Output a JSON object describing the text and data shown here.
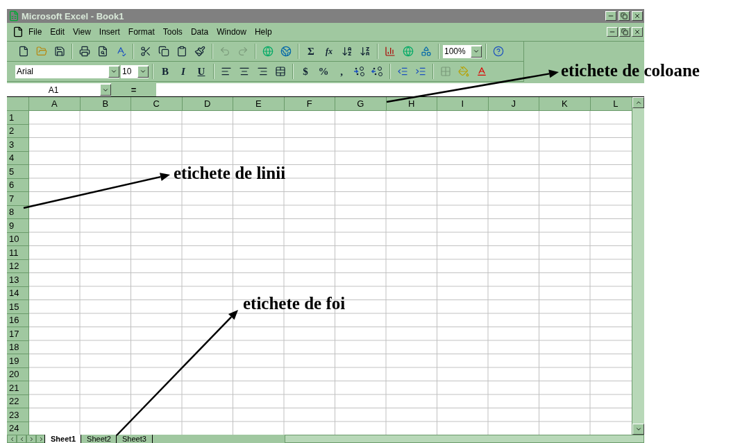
{
  "window": {
    "title": "Microsoft Excel - Book1"
  },
  "menu": [
    "File",
    "Edit",
    "View",
    "Insert",
    "Format",
    "Tools",
    "Data",
    "Window",
    "Help"
  ],
  "standard_toolbar": {
    "sum_label": "Σ",
    "function_label": "fx",
    "zoom": "100%"
  },
  "formatting_toolbar": {
    "font": "Arial",
    "size": "10",
    "bold": "B",
    "italic": "I",
    "underline": "U",
    "currency": "$",
    "percent": "%",
    "comma": ","
  },
  "formula_bar": {
    "name_box": "A1",
    "equals": "="
  },
  "columns": [
    "A",
    "B",
    "C",
    "D",
    "E",
    "F",
    "G",
    "H",
    "I",
    "J",
    "K",
    "L"
  ],
  "rows": [
    "1",
    "2",
    "3",
    "4",
    "5",
    "6",
    "7",
    "8",
    "9",
    "10",
    "11",
    "12",
    "13",
    "14",
    "15",
    "16",
    "17",
    "18",
    "19",
    "20",
    "21",
    "22",
    "23",
    "24"
  ],
  "sheet_tabs": [
    {
      "label": "Sheet1",
      "selected": true
    },
    {
      "label": "Sheet2",
      "selected": false
    },
    {
      "label": "Sheet3",
      "selected": false
    }
  ],
  "annotations": [
    {
      "kind": "columns",
      "text": "etichete de coloane"
    },
    {
      "kind": "rows",
      "text": "etichete de linii"
    },
    {
      "kind": "sheets",
      "text": "etichete de foi"
    }
  ]
}
